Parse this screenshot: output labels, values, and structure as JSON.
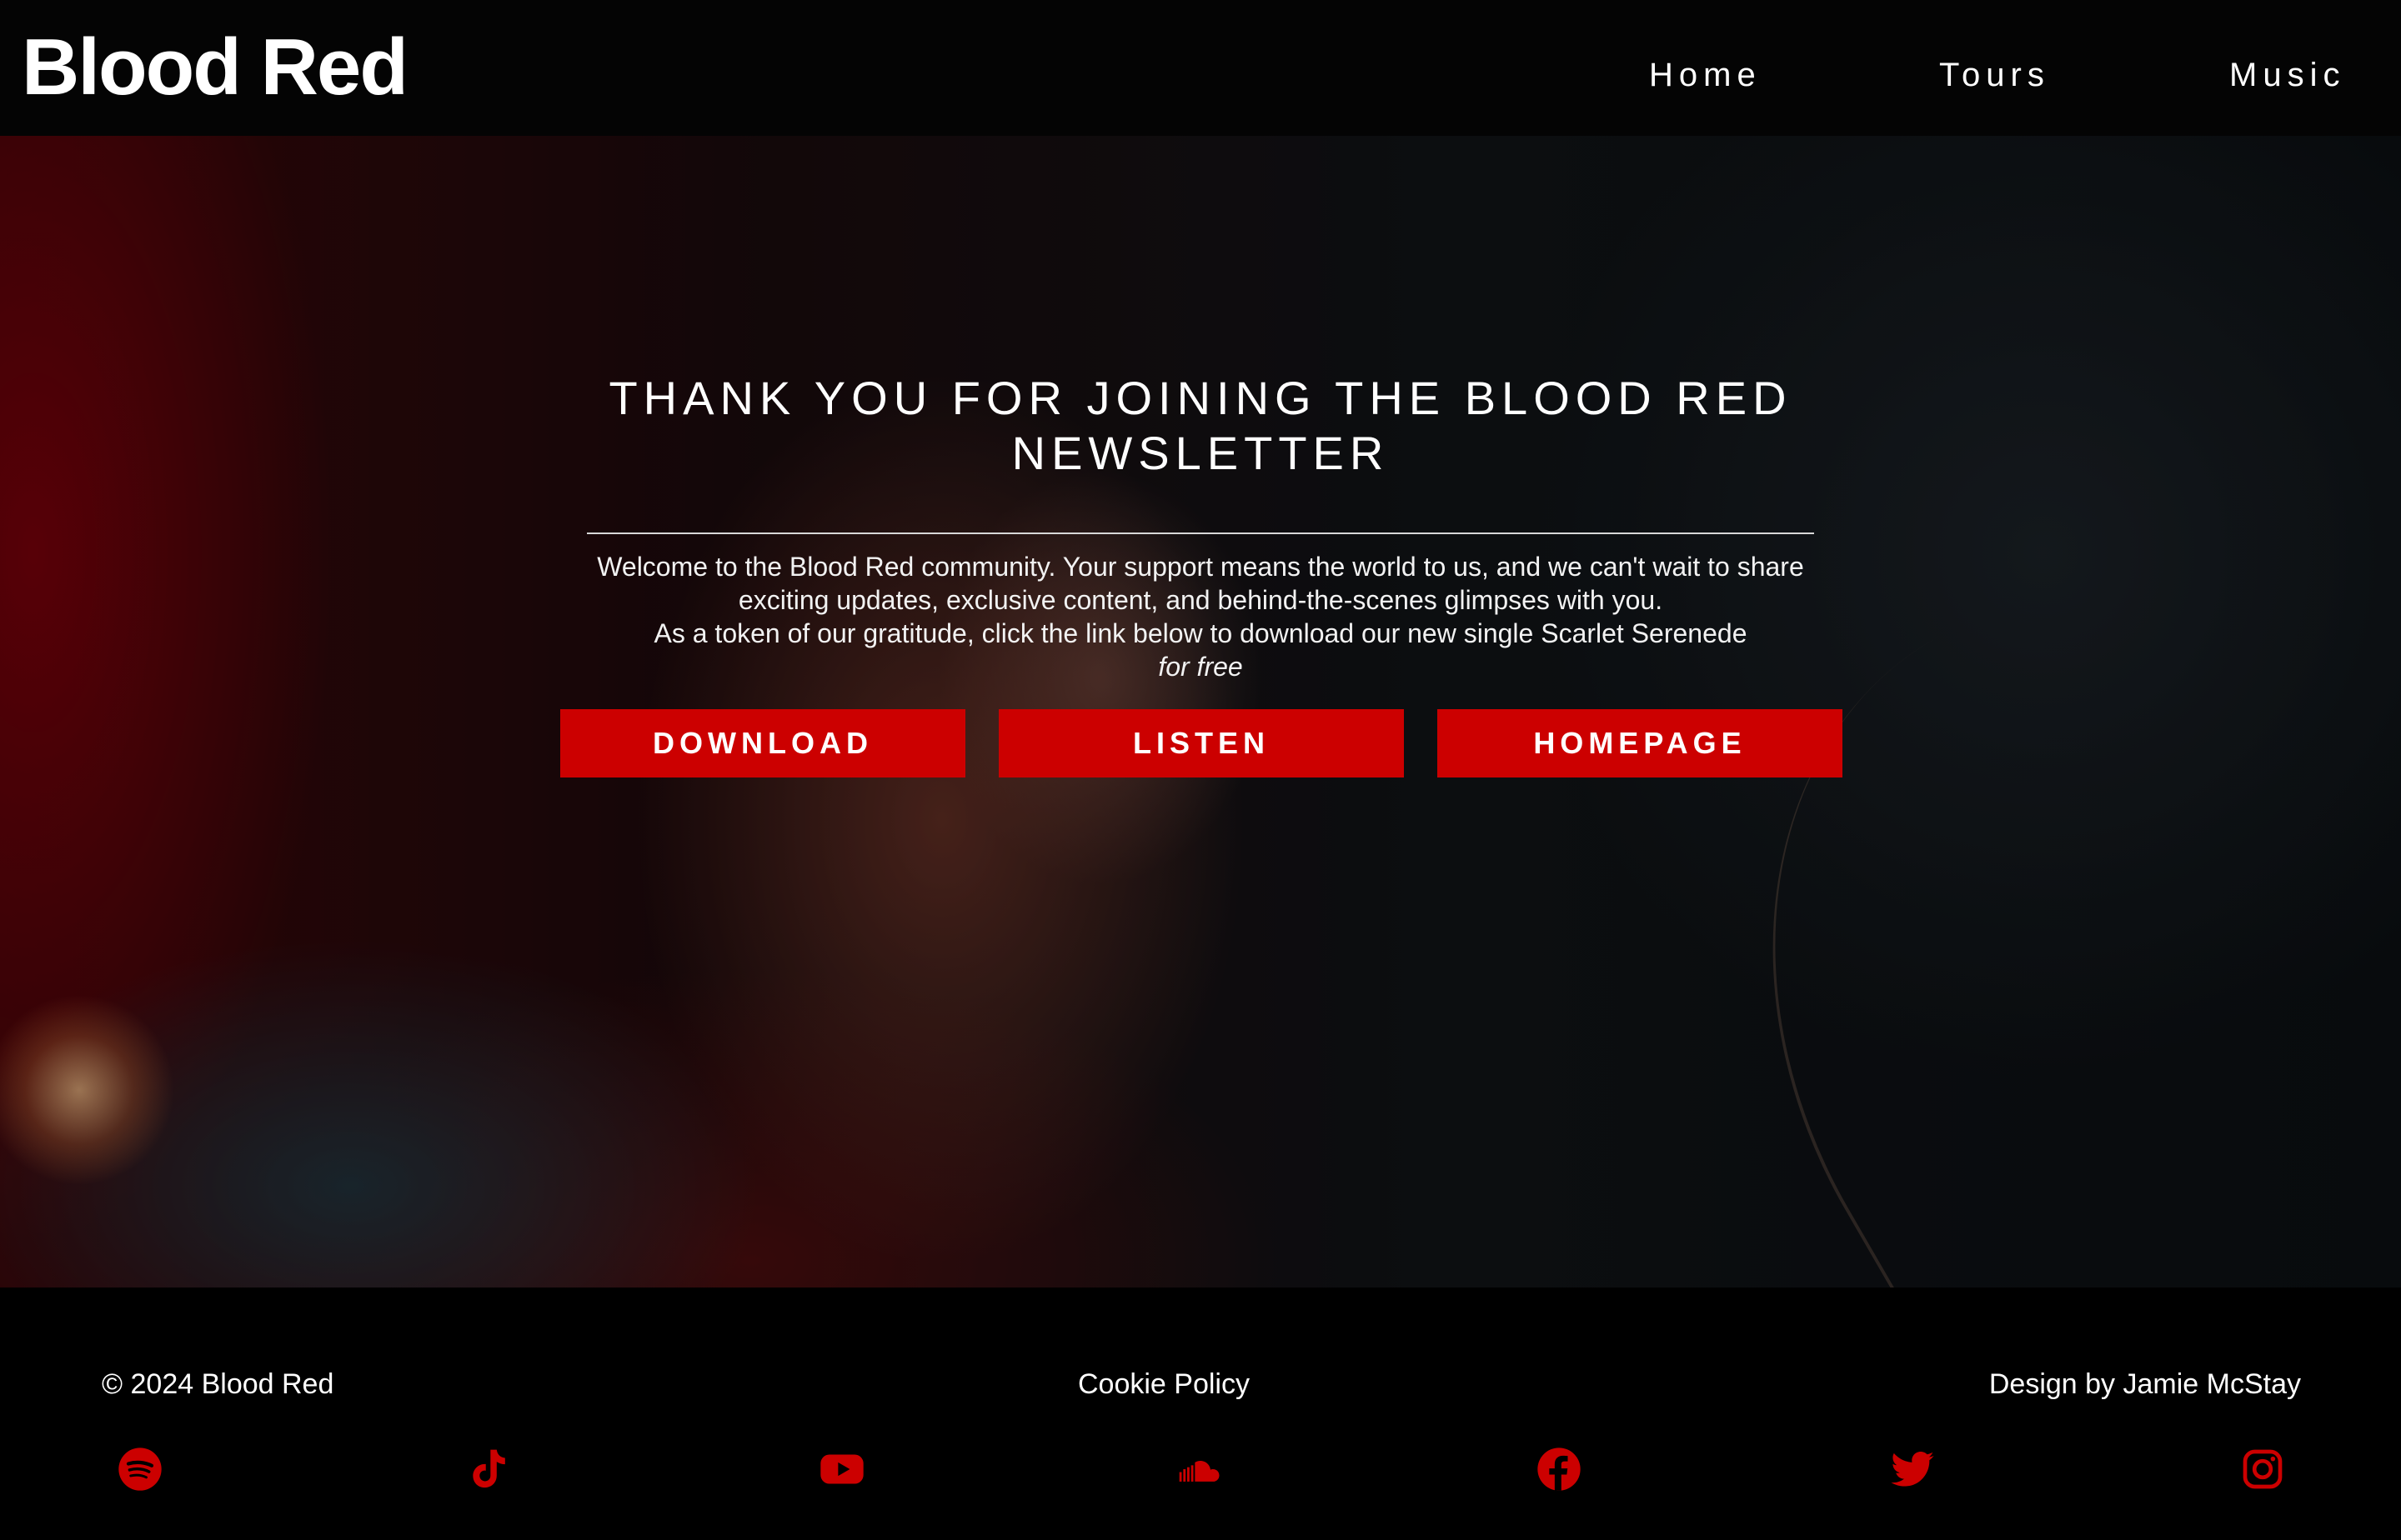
{
  "header": {
    "brand": "Blood Red",
    "nav": [
      {
        "label": "Home"
      },
      {
        "label": "Tours"
      },
      {
        "label": "Music"
      }
    ]
  },
  "hero": {
    "title": "THANK YOU FOR JOINING THE BLOOD RED NEWSLETTER",
    "intro": "Welcome to the Blood Red community. Your support means the world to us, and we can't wait to share exciting updates, exclusive content, and behind-the-scenes glimpses with you.",
    "token": "As a token of our gratitude, click the link below to download our new single Scarlet Serenede",
    "free": "for free",
    "buttons": [
      {
        "label": "DOWNLOAD"
      },
      {
        "label": "LISTEN"
      },
      {
        "label": "HOMEPAGE"
      }
    ]
  },
  "footer": {
    "copyright": "© 2024 Blood Red",
    "cookie": "Cookie Policy",
    "credit": "Design by Jamie McStay",
    "socials": [
      {
        "icon": "spotify-icon"
      },
      {
        "icon": "tiktok-icon"
      },
      {
        "icon": "youtube-icon"
      },
      {
        "icon": "soundcloud-icon"
      },
      {
        "icon": "facebook-icon"
      },
      {
        "icon": "twitter-icon"
      },
      {
        "icon": "instagram-icon"
      }
    ]
  },
  "colors": {
    "accent": "#cc0000",
    "background": "#000000",
    "text": "#ffffff"
  }
}
